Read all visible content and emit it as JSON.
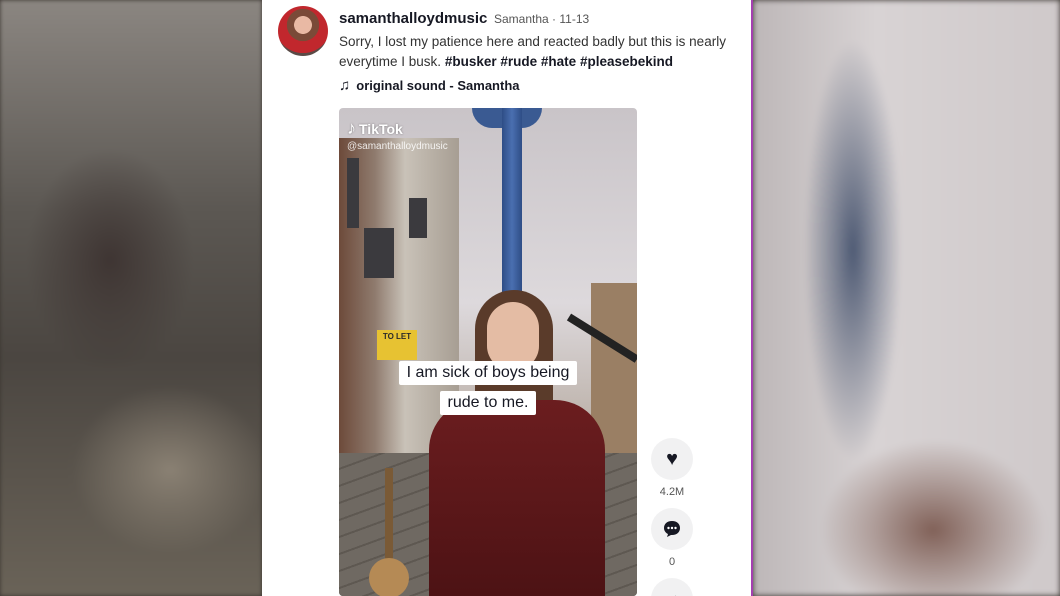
{
  "post": {
    "username": "samanthalloydmusic",
    "meta": "Samantha · 11-13",
    "caption": "Sorry, I lost my patience here and reacted badly but this is nearly everytime I busk.",
    "hashtags": [
      "#busker",
      "#rude",
      "#hate",
      "#pleasebekind"
    ],
    "sound": "original sound - Samantha"
  },
  "video": {
    "watermark": "TikTok",
    "handle": "@samanthalloydmusic",
    "overlay_line1": "I am sick of boys being",
    "overlay_line2": "rude to me.",
    "shop_sign": "TO LET"
  },
  "actions": {
    "likes": "4.2M",
    "comments": "0"
  },
  "icons": {
    "like": "heart-icon",
    "comment": "comment-icon",
    "share": "share-icon",
    "music": "music-note-icon"
  },
  "colors": {
    "divider": "#a43fb0",
    "text_primary": "#161823"
  }
}
